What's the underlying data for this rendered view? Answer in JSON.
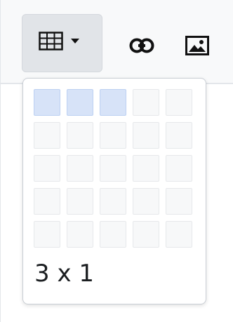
{
  "toolbar": {
    "buttons": [
      {
        "name": "table",
        "icon": "table-grid-icon",
        "has_dropdown": true,
        "active": true
      },
      {
        "name": "link",
        "icon": "link-icon"
      },
      {
        "name": "image",
        "icon": "image-icon"
      }
    ]
  },
  "table_picker": {
    "rows": 5,
    "columns": 5,
    "selected_columns": 3,
    "selected_rows": 1,
    "size_label": "3 x 1"
  },
  "colors": {
    "selected_cell": "#d7e3f8",
    "cell": "#f7f8f9",
    "active_button_bg": "#e1e4e8"
  }
}
